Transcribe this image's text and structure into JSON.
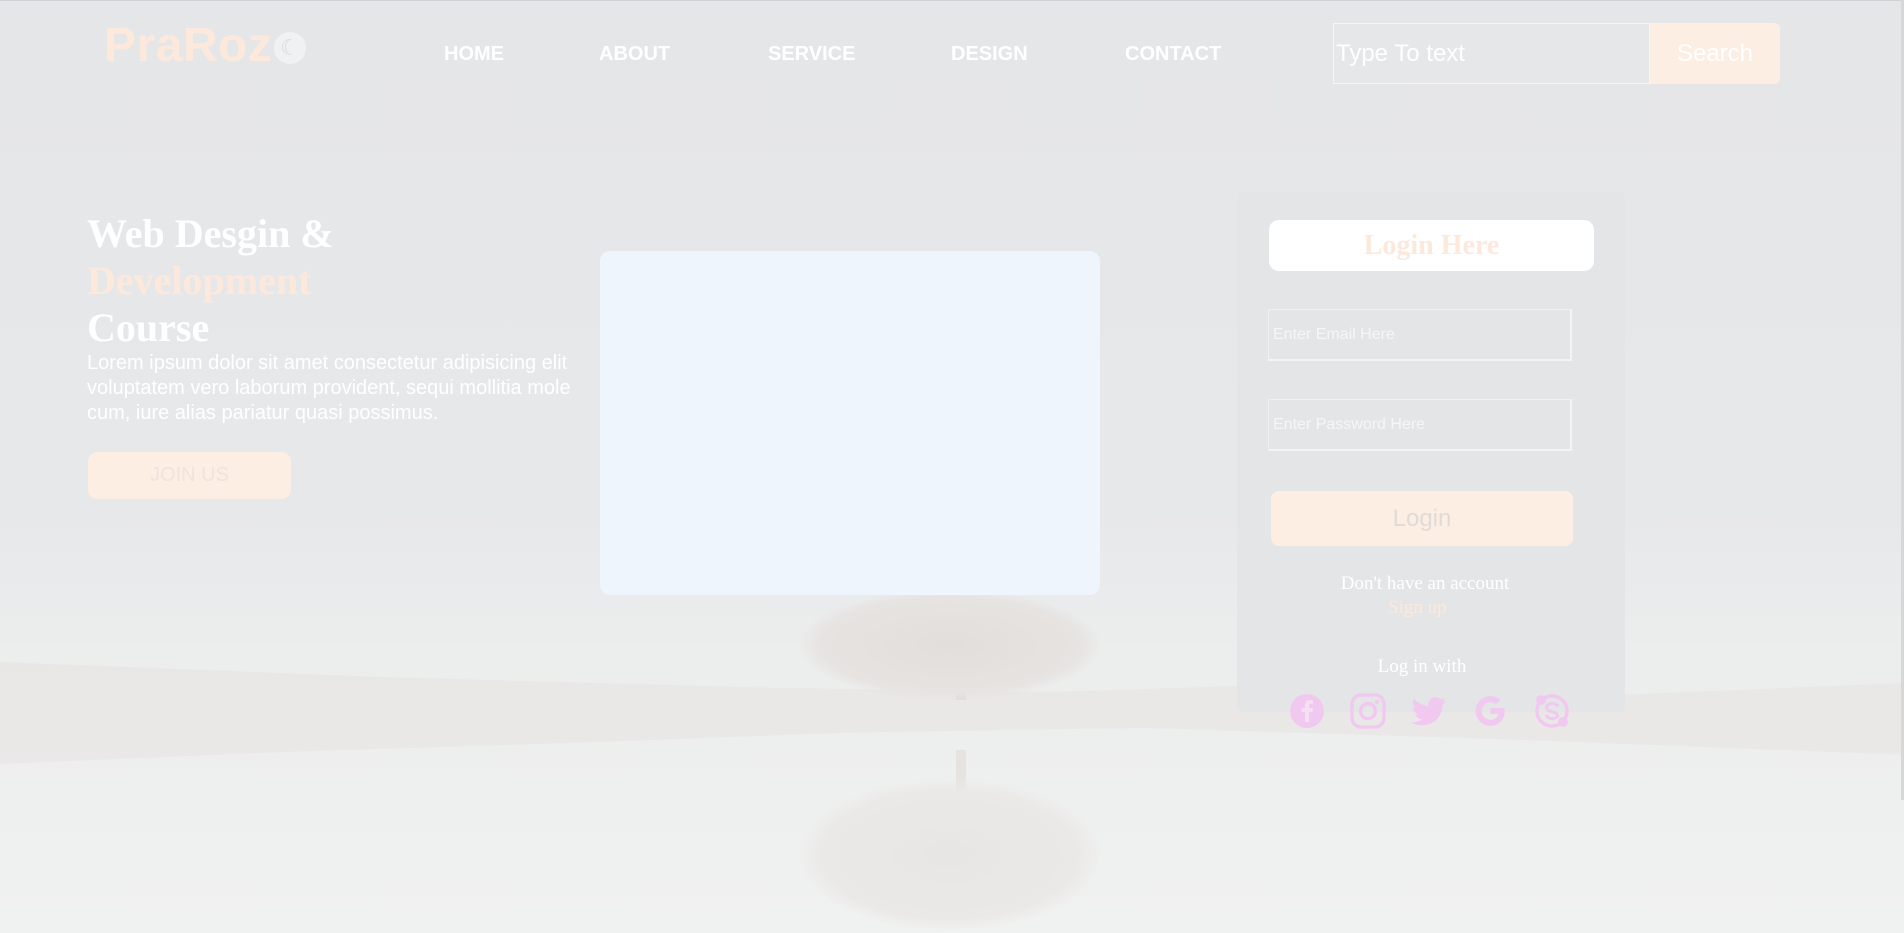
{
  "header": {
    "logo_text": "PraRoz",
    "logo_symbol": "☾",
    "nav": [
      "HOME",
      "ABOUT",
      "SERVICE",
      "DESIGN",
      "CONTACT"
    ],
    "search": {
      "placeholder": "Type To text",
      "button_label": "Search"
    }
  },
  "hero": {
    "title_line1": "Web Desgin &",
    "title_line2": "Development",
    "title_line3": "Course",
    "body": "Lorem ipsum dolor sit amet consectetur adipisicing elit\nvoluptatem vero laborum provident, sequi mollitia mole\ncum, iure alias pariatur quasi possimus.",
    "join_label": "JOIN US"
  },
  "login": {
    "title": "Login Here",
    "email_placeholder": "Enter Email Here",
    "password_placeholder": "Enter Password Here",
    "button_label": "Login",
    "no_account_text": "Don't have an account",
    "signup_label": "Sign up",
    "login_with_text": "Log in with",
    "social_icons": [
      "facebook-icon",
      "instagram-icon",
      "twitter-icon",
      "google-icon",
      "skype-icon"
    ]
  },
  "colors": {
    "accent_peach": "#fde9dc",
    "button_peach": "#fdeee3",
    "social_pink": "#f1c9f0",
    "panel_blue": "#eef5fc"
  }
}
